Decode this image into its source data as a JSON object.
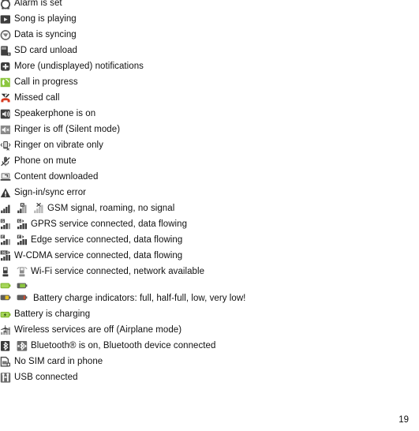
{
  "document": {
    "page_number": "19",
    "type": "status-bar-icon-legend"
  },
  "rows": [
    {
      "icon": "alarm-clock-icon",
      "label": "Alarm is set"
    },
    {
      "icon": "play-song-icon",
      "label": "Song is playing"
    },
    {
      "icon": "data-sync-icon",
      "label": "Data is syncing"
    },
    {
      "icon": "sd-card-unload-icon",
      "label": "SD card unload"
    },
    {
      "icon": "more-notifications-icon",
      "label": "More (undisplayed) notifications"
    },
    {
      "icon": "call-in-progress-icon",
      "label": "Call in progress"
    },
    {
      "icon": "missed-call-icon",
      "label": "Missed call"
    },
    {
      "icon": "speakerphone-icon",
      "label": "Speakerphone is on"
    },
    {
      "icon": "ringer-off-icon",
      "label": "Ringer is off (Silent mode)"
    },
    {
      "icon": "vibrate-icon",
      "label": "Ringer on vibrate only"
    },
    {
      "icon": "mute-icon",
      "label": "Phone on mute"
    },
    {
      "icon": "content-downloaded-icon",
      "label": "Content downloaded"
    },
    {
      "icon": "sign-in-error-icon",
      "label": "Sign-in/sync error"
    },
    {
      "icons": [
        "gsm-signal-full-icon",
        "gsm-roaming-icon",
        "gsm-no-signal-icon"
      ],
      "label": "GSM signal, roaming, no signal"
    },
    {
      "icons": [
        "gprs-connected-icon",
        "gprs-data-flowing-icon"
      ],
      "label": "GPRS service connected, data flowing"
    },
    {
      "icons": [
        "edge-connected-icon",
        "edge-data-flowing-icon"
      ],
      "label": "Edge service connected, data flowing"
    },
    {
      "icons": [
        "wcdma-icon"
      ],
      "label": "W-CDMA service connected, data flowing"
    },
    {
      "icons": [
        "wifi-connected-icon",
        "wifi-available-icon"
      ],
      "label": "Wi-Fi service connected, network available"
    },
    {
      "icons": [
        "battery-full-icon",
        "battery-half-full-icon",
        "battery-low-icon",
        "battery-very-low-icon"
      ],
      "label": "Battery charge indicators: full, half-full, low, very low!"
    },
    {
      "icon": "battery-charging-icon",
      "label": "Battery is charging"
    },
    {
      "icon": "airplane-mode-icon",
      "label": "Wireless services are off (Airplane mode)"
    },
    {
      "icons": [
        "bluetooth-on-icon",
        "bluetooth-connected-icon"
      ],
      "label": "Bluetooth® is on, Bluetooth device connected"
    },
    {
      "icon": "no-sim-card-icon",
      "label": "No SIM card in phone"
    },
    {
      "icon": "usb-connected-icon",
      "label": "USB connected"
    }
  ],
  "colors": {
    "icon_dark": "#3a3a3a",
    "icon_mid": "#6e6e6e",
    "icon_light": "#bdbdbd",
    "green": "#7db52a",
    "green_bright": "#8cc63f",
    "red": "#d63a21",
    "yellow": "#e8c020",
    "orange_red": "#cf5a2c",
    "text": "#111111",
    "background": "#ffffff"
  }
}
